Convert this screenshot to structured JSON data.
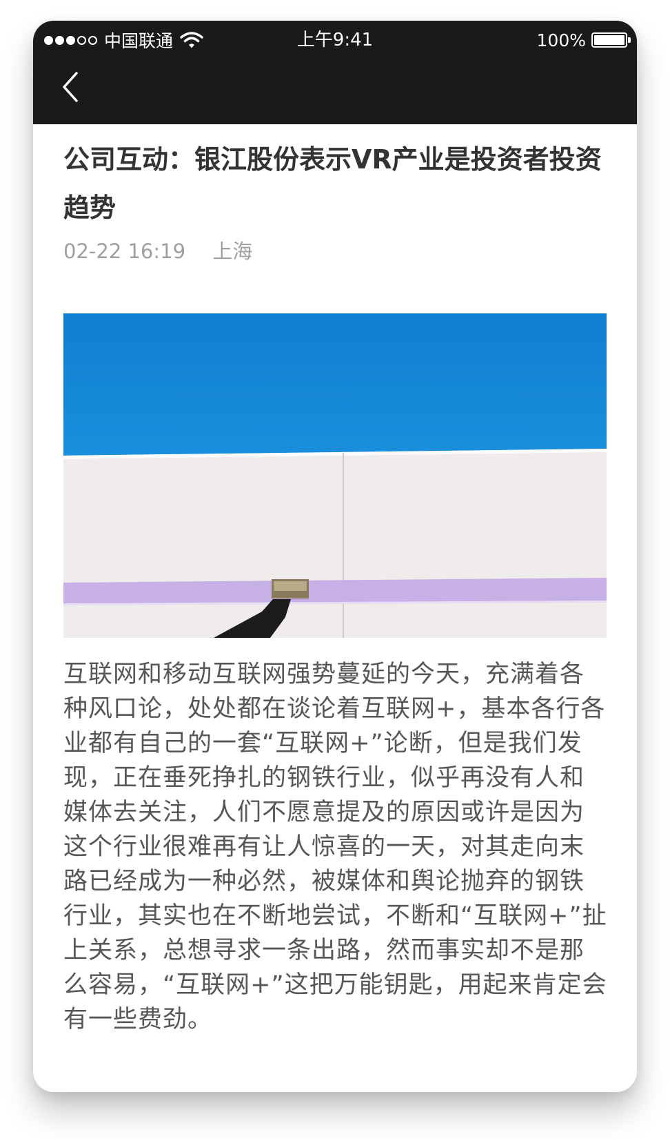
{
  "status_bar": {
    "carrier": "中国联通",
    "time": "上午9:41",
    "battery": "100%",
    "signal_bars_filled": 3,
    "signal_bars_total": 5,
    "battery_level": 1.0
  },
  "nav": {
    "back_icon": "chevron-left-icon"
  },
  "article": {
    "title": "公司互动：银江股份表示VR产业是投资者投资趋势",
    "date": "02-22 16:19",
    "location": "上海",
    "image_subject": "blue-sky-and-wall-photo",
    "body": "互联网和移动互联网强势蔓延的今天，充满着各种风口论，处处都在谈论着互联网+，基本各行各业都有自己的一套“互联网+”论断，但是我们发现，正在垂死挣扎的钢铁行业，似乎再没有人和媒体去关注，人们不愿意提及的原因或许是因为这个行业很难再有让人惊喜的一天，对其走向末路已经成为一种必然，被媒体和舆论抛弃的钢铁行业，其实也在不断地尝试，不断和“互联网+”扯上关系，总想寻求一条出路，然而事实却不是那么容易，“互联网+”这把万能钥匙，用起来肯定会有一些费劲。"
  },
  "colors": {
    "topbar": "#1a1a1a",
    "title": "#333333",
    "meta": "#a0a0a0",
    "body": "#575757",
    "sky": "#1486d2",
    "wall": "#f1ecec",
    "stripe": "#c7b0e6"
  }
}
